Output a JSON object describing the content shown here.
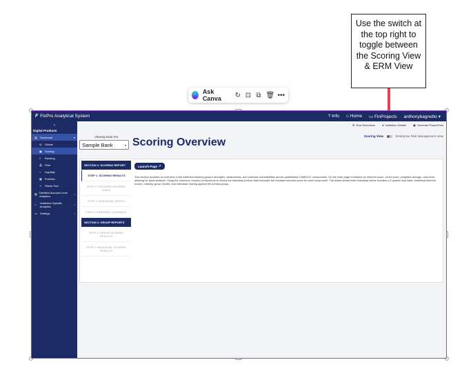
{
  "callout": {
    "text": "Use the switch at the top right to toggle between the Scoring View & ERM View"
  },
  "canva_toolbar": {
    "ask_label": "Ask Canva",
    "icons": [
      "canva-logo",
      "refresh-icon",
      "lock-icon",
      "duplicate-icon",
      "trash-icon",
      "more-icon"
    ]
  },
  "app": {
    "title": "FinPro Analytical System",
    "nav": {
      "info": "Info",
      "home": "Home",
      "user": "FinProjects",
      "account": "anthonybagnetto"
    },
    "colors": {
      "navy": "#1d2b64",
      "active": "#3552a6",
      "accent_red": "#e8414f"
    }
  },
  "sidebar": {
    "collapse_glyph": "‹",
    "heading": "Digital Products",
    "items": [
      {
        "label": "Scorecard",
        "icon": "scorecard-icon"
      },
      {
        "label": "Global",
        "icon": "globe-icon"
      },
      {
        "label": "Scoring",
        "icon": "scoring-icon"
      },
      {
        "label": "Ranking",
        "icon": "ranking-icon"
      },
      {
        "label": "Peer",
        "icon": "peer-icon"
      },
      {
        "label": "Liquidity",
        "icon": "liquidity-icon"
      },
      {
        "label": "Portfolio",
        "icon": "portfolio-icon"
      },
      {
        "label": "Stress Test",
        "icon": "stress-test-icon"
      },
      {
        "label": "Detailed Account Level Analytics",
        "icon": "chart-icon"
      },
      {
        "label": "Institution Specific Analytics",
        "icon": "bank-icon"
      },
      {
        "label": "Settings",
        "icon": "settings-icon"
      }
    ]
  },
  "actions": {
    "row_selections": "Row Selections",
    "institution_details": "Institution Details",
    "generate_ppt": "Generate PowerPoint"
  },
  "view_toggle": {
    "scoring_view": "Scoring View",
    "erm_view": "Enterprise Risk Management View"
  },
  "bank_selector": {
    "label": "Viewing Data For:",
    "value": "Sample Bank"
  },
  "page": {
    "title": "Scoring Overview",
    "launch_label": "Launch Page",
    "description": "This section provides an overview of the institution/ranking group's strengths, weaknesses, and potential vulnerabilities across quantitative CAMELS+ components. On the main page it features an inherent score, worst score, weighted average, and trend allowing for quick analysis. Using the chevrons, expand components to review the individual metrics that formulate the resultant inherent score for each component. The detail behind each individual metric includes a 5 quarter look back, individual inherent scores, ordinary group results, and individual ranking against the primary group."
  },
  "steps": {
    "section1": "SECTION 1: SCORING REPORT",
    "s1_items": [
      "STEP 1: SCORING RESULTS",
      "STEP 2: ELEVATED SCORING RISKS",
      "STEP 3: INDIVIDUAL RATIOS",
      "STEP 4: INHERENT LOOKBACK"
    ],
    "section2": "SECTION 2: GROUP REPORTS",
    "s2_items": [
      "STEP 1: GROUP SCORING RESULTS",
      "STEP 2: INDIVIDUAL SCORING RESULTS"
    ]
  }
}
